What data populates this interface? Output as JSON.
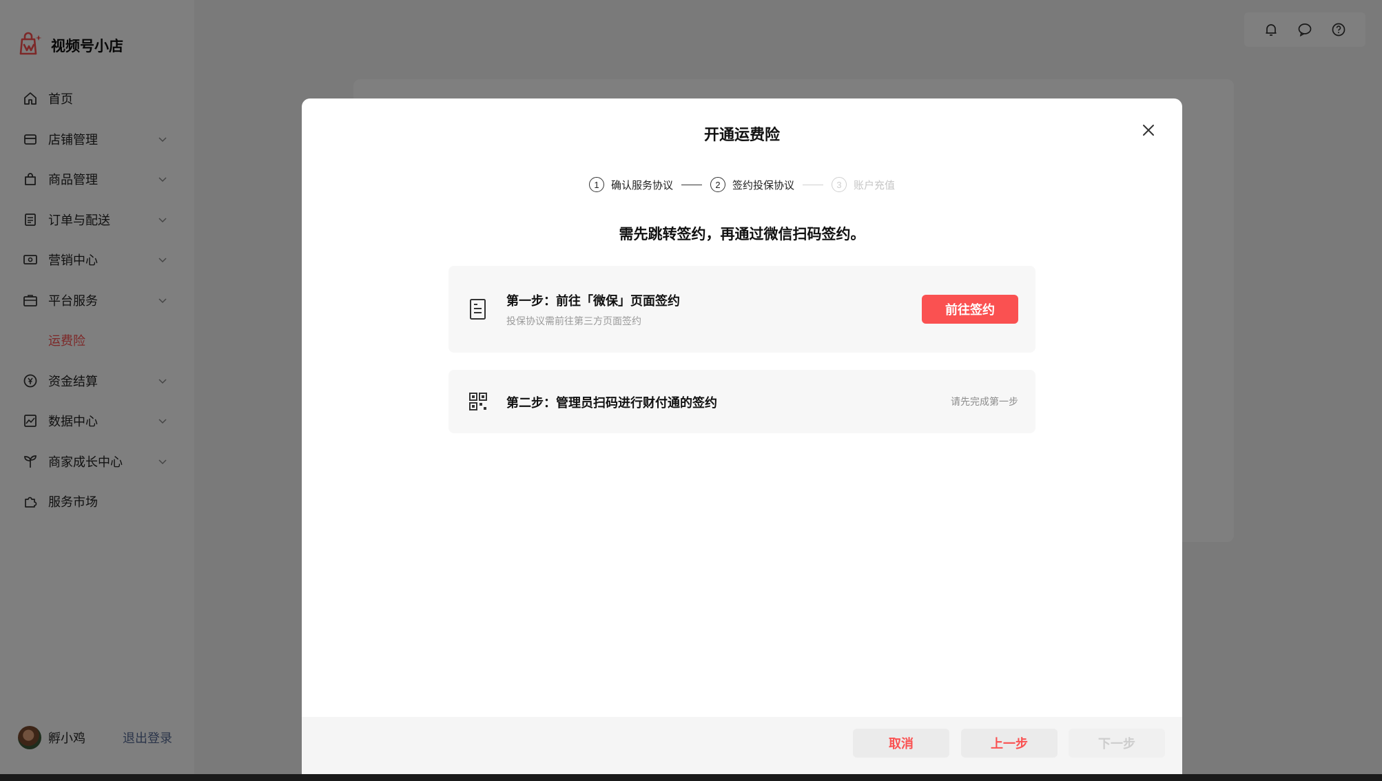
{
  "app": {
    "name": "视频号小店"
  },
  "colors": {
    "accent": "#fa5151",
    "link": "#576b95"
  },
  "sidebar": {
    "items": [
      {
        "label": "首页",
        "icon": "home-icon",
        "has_children": false
      },
      {
        "label": "店铺管理",
        "icon": "store-icon",
        "has_children": true
      },
      {
        "label": "商品管理",
        "icon": "shopping-bag-icon",
        "has_children": true
      },
      {
        "label": "订单与配送",
        "icon": "order-list-icon",
        "has_children": true
      },
      {
        "label": "营销中心",
        "icon": "coupon-icon",
        "has_children": true
      },
      {
        "label": "平台服务",
        "icon": "briefcase-icon",
        "has_children": true,
        "expanded": true
      },
      {
        "label": "运费险",
        "sub": true,
        "active": true
      },
      {
        "label": "资金结算",
        "icon": "yuan-icon",
        "has_children": true
      },
      {
        "label": "数据中心",
        "icon": "chart-icon",
        "has_children": true
      },
      {
        "label": "商家成长中心",
        "icon": "sprout-icon",
        "has_children": true
      },
      {
        "label": "服务市场",
        "icon": "puzzle-icon",
        "has_children": false
      }
    ]
  },
  "user": {
    "name": "孵小鸡",
    "logout_label": "退出登录"
  },
  "header": {
    "icons": [
      "bell-icon",
      "message-icon",
      "help-icon"
    ]
  },
  "modal": {
    "title": "开通运费险",
    "steps": [
      {
        "num": "1",
        "label": "确认服务协议",
        "state": "done"
      },
      {
        "num": "2",
        "label": "签约投保协议",
        "state": "current"
      },
      {
        "num": "3",
        "label": "账户充值",
        "state": "pending"
      }
    ],
    "lead": "需先跳转签约，再通过微信扫码签约。",
    "step1": {
      "title": "第一步：前往「微保」页面签约",
      "subtitle": "投保协议需前往第三方页面签约",
      "button": "前往签约"
    },
    "step2": {
      "title": "第二步：管理员扫码进行财付通的签约",
      "hint": "请先完成第一步"
    },
    "footer": {
      "cancel": "取消",
      "prev": "上一步",
      "next": "下一步"
    }
  }
}
